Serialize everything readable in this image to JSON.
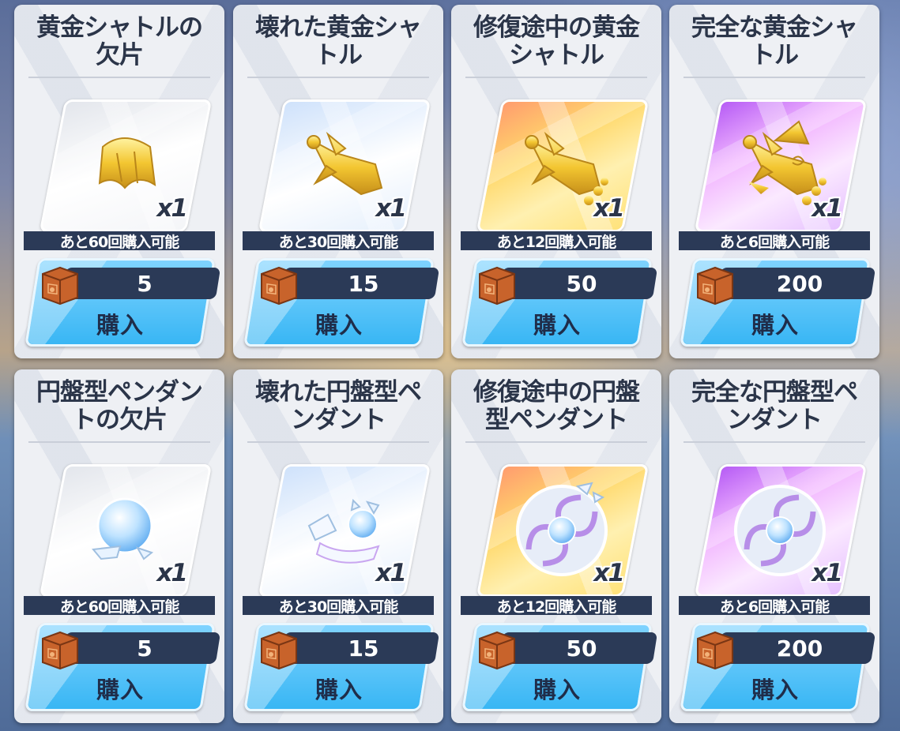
{
  "currency_icon": "supply-crate-icon",
  "quantity_label": "x1",
  "colors": {
    "card_bg": "#eef0f4",
    "dark_bar": "#2b3a57",
    "buy_button": "#38b6f4",
    "title_text": "#2b3549"
  },
  "cards": [
    {
      "title": "黄金シャトルの欠片",
      "item_icon": "golden-shuttle-fragment-icon",
      "rarity": "common",
      "limit": "あと60回購入可能",
      "price": "5",
      "buy": "購入"
    },
    {
      "title": "壊れた黄金シャトル",
      "item_icon": "broken-golden-shuttle-icon",
      "rarity": "uncommon",
      "limit": "あと30回購入可能",
      "price": "15",
      "buy": "購入"
    },
    {
      "title": "修復途中の黄金シャトル",
      "item_icon": "repairing-golden-shuttle-icon",
      "rarity": "rare",
      "limit": "あと12回購入可能",
      "price": "50",
      "buy": "購入"
    },
    {
      "title": "完全な黄金シャトル",
      "item_icon": "complete-golden-shuttle-icon",
      "rarity": "epic",
      "limit": "あと6回購入可能",
      "price": "200",
      "buy": "購入"
    },
    {
      "title": "円盤型ペンダントの欠片",
      "item_icon": "disc-pendant-fragment-icon",
      "rarity": "common",
      "limit": "あと60回購入可能",
      "price": "5",
      "buy": "購入"
    },
    {
      "title": "壊れた円盤型ペンダント",
      "item_icon": "broken-disc-pendant-icon",
      "rarity": "uncommon",
      "limit": "あと30回購入可能",
      "price": "15",
      "buy": "購入"
    },
    {
      "title": "修復途中の円盤型ペンダント",
      "item_icon": "repairing-disc-pendant-icon",
      "rarity": "rare",
      "limit": "あと12回購入可能",
      "price": "50",
      "buy": "購入"
    },
    {
      "title": "完全な円盤型ペンダント",
      "item_icon": "complete-disc-pendant-icon",
      "rarity": "epic",
      "limit": "あと6回購入可能",
      "price": "200",
      "buy": "購入"
    }
  ]
}
